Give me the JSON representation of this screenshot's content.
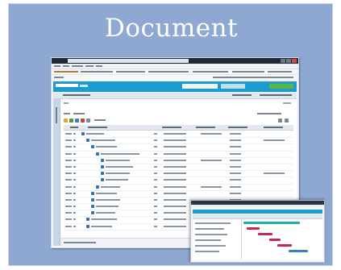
{
  "slide": {
    "title": "Document",
    "background_color": "#8ea8d2"
  },
  "browser": {
    "title_bar_color": "#1f2836",
    "window_buttons": [
      "minimize-icon",
      "maximize-icon",
      "close-icon"
    ]
  },
  "app": {
    "header_color": "#1d9bd1",
    "accent_green": "#57b843",
    "logo_text": ""
  },
  "grid": {
    "row_count": 15,
    "row_icon_color": "#2f6fb2"
  },
  "gantt": {
    "header_color": "#1d9bd1",
    "bar_colors": [
      "#17b3b0",
      "#c0285c",
      "#3b7cc4"
    ]
  }
}
